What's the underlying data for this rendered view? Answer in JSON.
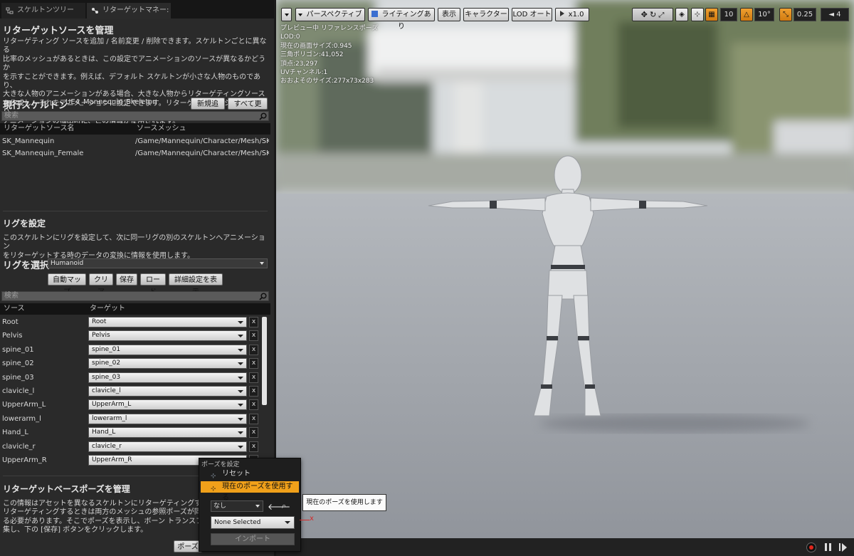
{
  "tabs": [
    {
      "label": "スケルトンツリー"
    },
    {
      "label": "リターゲットマネー:"
    }
  ],
  "retarget_source": {
    "title": "リターゲットソースを管理",
    "description_lines": [
      "リターゲティング ソースを追加 / 名前変更 / 削除できます。スケルトンごとに異なる",
      "比率のメッシュがあるときは、この設定でアニメーションのソースが異なるかどうか",
      "を示すことができます。例えば、デフォルト スケルトンが小さな人物のものであり、",
      "大きな人物のアニメーションがある場合、大きな人物からリターゲティングソース",
      "を作成し、それをアニメーションに設定できます。リターゲティング システムにより、",
      "アニメーションの抽出時に、この情報が使用されます。"
    ],
    "current_skeleton_label": "現行スケルトン",
    "current_skeleton_value": "UE4_Mannequin_Skeleton",
    "add_new_button": "新規追加",
    "update_all_button": "すべて更新",
    "search_placeholder": "検索",
    "columns": [
      "リターゲットソース名",
      "ソースメッシュ"
    ],
    "rows": [
      {
        "name": "SK_Mannequin",
        "mesh": "/Game/Mannequin/Character/Mesh/SK_Ma"
      },
      {
        "name": "SK_Mannequin_Female",
        "mesh": "/Game/Mannequin/Character/Mesh/SK_Ma"
      }
    ]
  },
  "rig_setup": {
    "title": "リグを設定",
    "description_lines": [
      "このスケルトンにリグを設定して、次に同一リグの別のスケルトンへアニメーション",
      "をリターゲットする時のデータの変換に情報を使用します。"
    ],
    "select_rig_label": "リグを選択",
    "selected_rig": "Humanoid",
    "buttons": {
      "auto_map": "自動マップ",
      "clear": "クリア",
      "save": "保存",
      "load": "ロード",
      "advanced": "詳細設定を表示"
    },
    "search_placeholder": "検索",
    "columns": [
      "ソース",
      "ターゲット"
    ],
    "clear_symbol": "x",
    "mappings": [
      {
        "source": "Root",
        "target": "Root"
      },
      {
        "source": "Pelvis",
        "target": "Pelvis"
      },
      {
        "source": "spine_01",
        "target": "spine_01"
      },
      {
        "source": "spine_02",
        "target": "spine_02"
      },
      {
        "source": "spine_03",
        "target": "spine_03"
      },
      {
        "source": "clavicle_l",
        "target": "clavicle_l"
      },
      {
        "source": "UpperArm_L",
        "target": "UpperArm_L"
      },
      {
        "source": "lowerarm_l",
        "target": "lowerarm_l"
      },
      {
        "source": "Hand_L",
        "target": "Hand_L"
      },
      {
        "source": "clavicle_r",
        "target": "clavicle_r"
      },
      {
        "source": "UpperArm_R",
        "target": "UpperArm_R"
      }
    ]
  },
  "base_pose": {
    "title": "リターゲットベースポーズを管理",
    "description_lines": [
      "この情報はアセットを異なるスケルトンにリターゲティングする",
      "リターゲティングするときは両方のメッシュの参照ポーズが同",
      "る必要があります。そこでポーズを表示し、ボーン トランスフォ",
      "集し、下の [保存] ボタンをクリックします。"
    ],
    "pose_button": "ポーズ"
  },
  "popup": {
    "header": "ポーズを設定",
    "items": [
      {
        "label": "リセット"
      },
      {
        "label": "現在のポーズを使用する"
      }
    ],
    "pose_combo": "なし",
    "mesh_combo": "None Selected",
    "import_button": "インポート",
    "red_x": "x"
  },
  "tooltip": "現在のポーズを使用します",
  "viewport_toolbar": {
    "perspective": "パースペクティブ",
    "lighting": "ライティングあり",
    "show": "表示",
    "character": "キャラクター",
    "lod": "LOD オート",
    "speed": "x1.0",
    "grid_snap": "10",
    "rot_snap": "10°",
    "scale_snap": "0.25",
    "camera_speed": "4"
  },
  "viewport_stats": [
    "プレビュー中 リファレンスポーズ",
    "LOD:0",
    "現在の画面サイズ:0.945",
    "三角ポリゴン:41,052",
    "頂点:23,297",
    "UVチャンネル:1",
    "おおよそのサイズ:277x73x283"
  ],
  "colors": {
    "accent": "#f0a01a",
    "panel": "#2a2a2a",
    "record": "#e0261c"
  }
}
